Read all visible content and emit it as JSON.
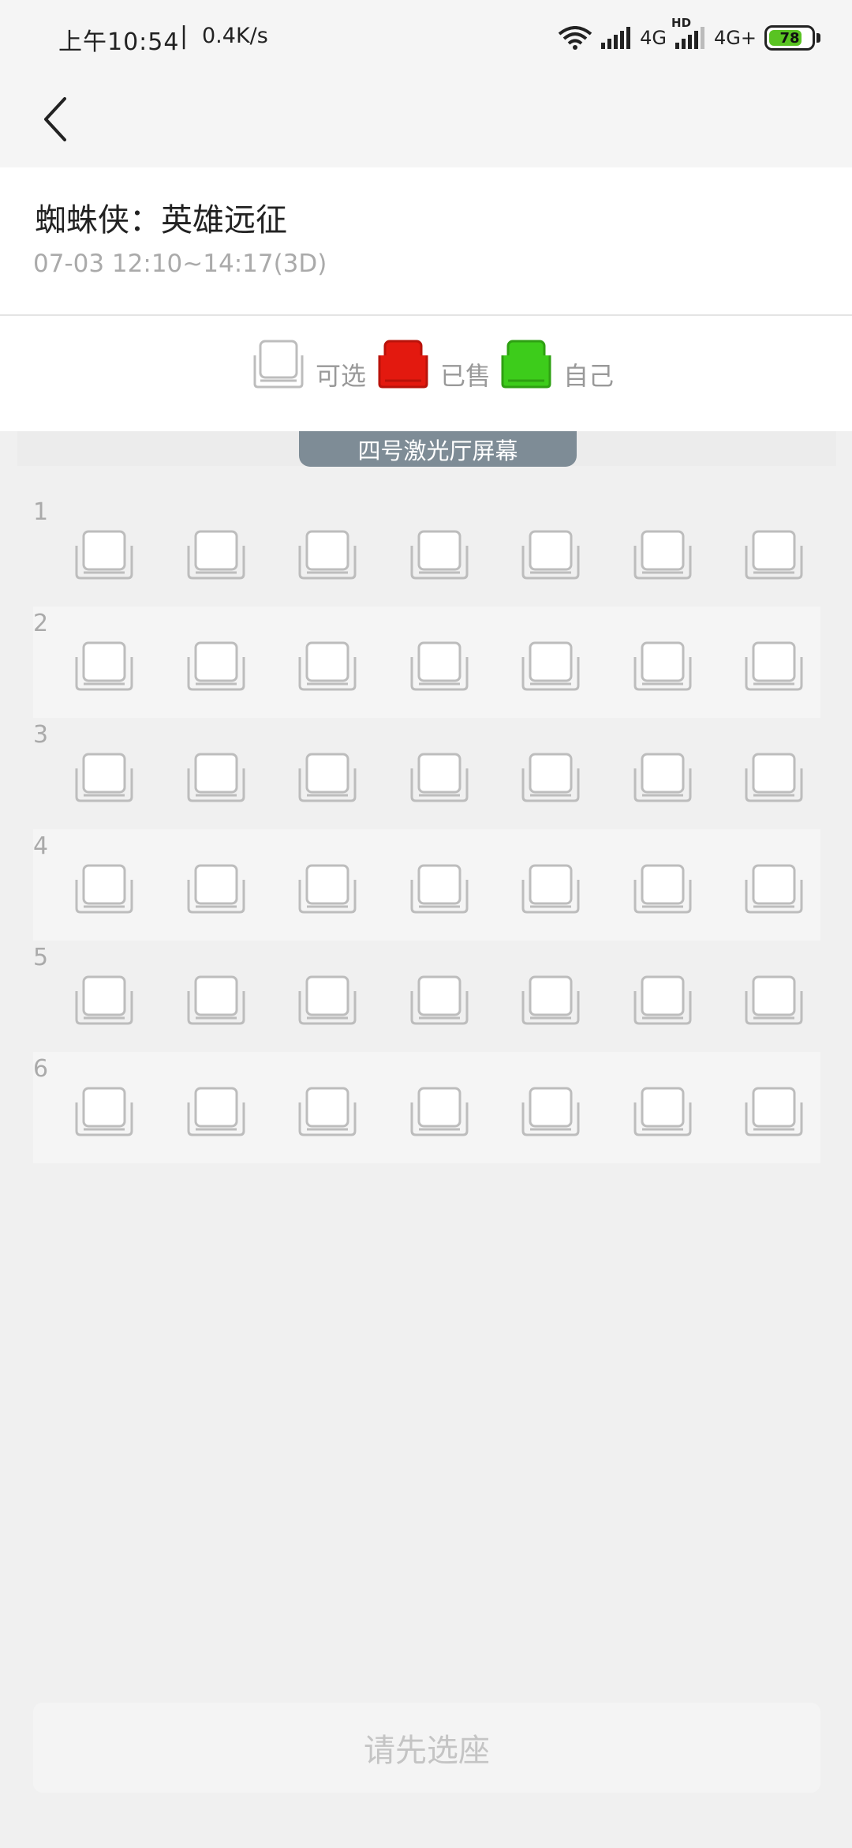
{
  "status_bar": {
    "time": "上午10:54",
    "separator": "|",
    "net_speed": "0.4K/s",
    "signal1_label": "4G",
    "hd_label": "HD",
    "signal2_label": "4G+",
    "battery_level": "78",
    "battery_color": "#59c322"
  },
  "nav": {
    "back_icon": "chevron-left-icon"
  },
  "movie": {
    "title": "蜘蛛侠：英雄远征",
    "showtime": "07-03 12:10~14:17(3D)"
  },
  "legend": {
    "available_label": "可选",
    "sold_label": "已售",
    "mine_label": "自己",
    "sold_color": "#e3190f",
    "mine_color": "#3dcc1b"
  },
  "hall": {
    "screen_label": "四号激光厅屏幕"
  },
  "seat_map": {
    "rows": [
      "1",
      "2",
      "3",
      "4",
      "5",
      "6"
    ],
    "seats_per_row": 7,
    "seat_state": "available"
  },
  "confirm": {
    "label": "请先选座"
  }
}
